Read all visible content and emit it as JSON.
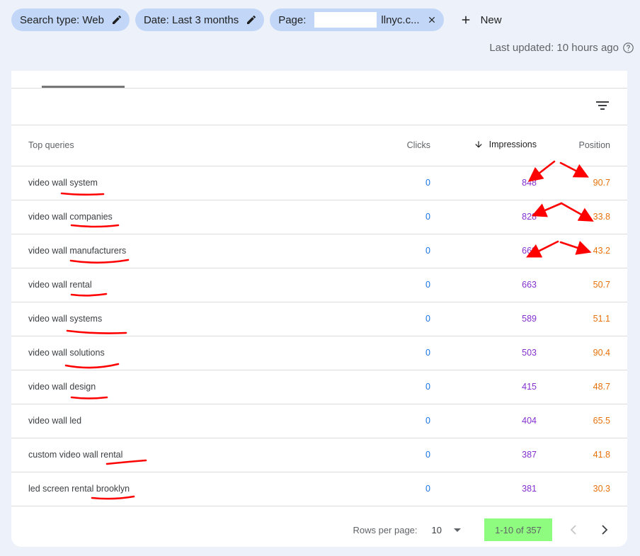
{
  "filters": {
    "search_type": "Search type: Web",
    "date": "Date: Last 3 months",
    "page_label": "Page:",
    "page_value": "llnyc.c...",
    "new_label": "New"
  },
  "last_updated": "Last updated: 10 hours ago",
  "table": {
    "headers": {
      "query": "Top queries",
      "clicks": "Clicks",
      "impressions": "Impressions",
      "position": "Position"
    },
    "rows": [
      {
        "query": "video wall system",
        "clicks": "0",
        "impressions": "848",
        "position": "90.7"
      },
      {
        "query": "video wall companies",
        "clicks": "0",
        "impressions": "828",
        "position": "33.8"
      },
      {
        "query": "video wall manufacturers",
        "clicks": "0",
        "impressions": "668",
        "position": "43.2"
      },
      {
        "query": "video wall rental",
        "clicks": "0",
        "impressions": "663",
        "position": "50.7"
      },
      {
        "query": "video wall systems",
        "clicks": "0",
        "impressions": "589",
        "position": "51.1"
      },
      {
        "query": "video wall solutions",
        "clicks": "0",
        "impressions": "503",
        "position": "90.4"
      },
      {
        "query": "video wall design",
        "clicks": "0",
        "impressions": "415",
        "position": "48.7"
      },
      {
        "query": "video wall led",
        "clicks": "0",
        "impressions": "404",
        "position": "65.5"
      },
      {
        "query": "custom video wall rental",
        "clicks": "0",
        "impressions": "387",
        "position": "41.8"
      },
      {
        "query": "led screen rental brooklyn",
        "clicks": "0",
        "impressions": "381",
        "position": "30.3"
      }
    ]
  },
  "pagination": {
    "rows_per_page_label": "Rows per page:",
    "rows_per_page_value": "10",
    "range": "1-10 of 357"
  },
  "colors": {
    "chip_bg": "#c2d7f7",
    "clicks": "#1a73e8",
    "impressions": "#8430ce",
    "position": "#e8710a",
    "annotation": "#ff0000",
    "range_highlight": "#8efc7f"
  },
  "icons": [
    "pencil-icon",
    "close-icon",
    "plus-icon",
    "help-icon",
    "filter-icon",
    "arrow-down-icon",
    "caret-down-icon",
    "chevron-left-icon",
    "chevron-right-icon"
  ]
}
